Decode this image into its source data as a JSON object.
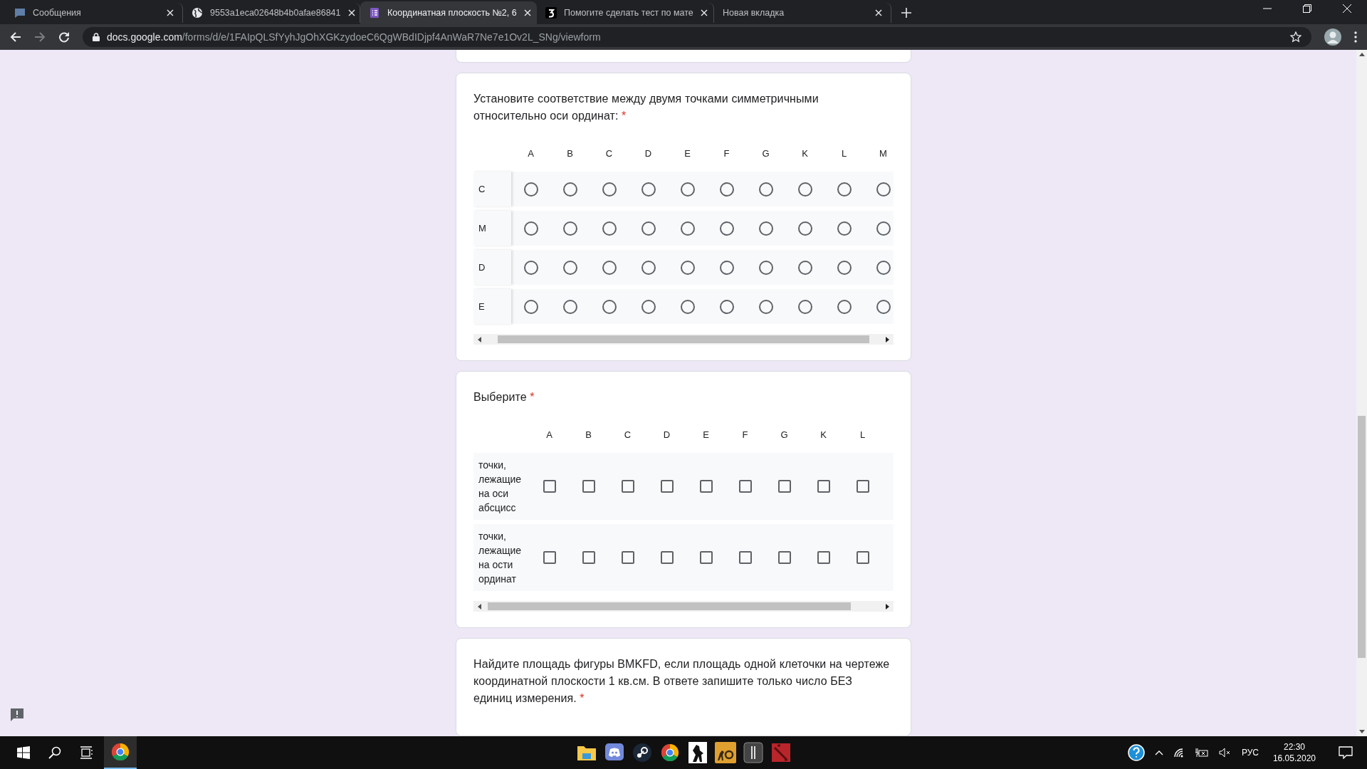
{
  "browser": {
    "tabs": [
      {
        "kind": "chat",
        "title": "Сообщения",
        "selected": false
      },
      {
        "kind": "globe",
        "title": "9553a1eca02648b4b0afae86841",
        "selected": false
      },
      {
        "kind": "forms",
        "title": "Координатная плоскость №2, 6",
        "selected": true
      },
      {
        "kind": "logo",
        "title": "Помогите сделать тест по мате",
        "selected": false
      },
      {
        "kind": "none",
        "title": "Новая вкладка",
        "selected": false
      }
    ],
    "address": {
      "domain": "docs.google.com",
      "path": "/forms/d/e/1FAIpQLSfYyhJgOhXGKzydoeC6QgWBdIDjpf4AnWaR7Ne7e1Ov2L_SNg/viewform"
    },
    "forward_disabled": true
  },
  "form": {
    "questions": [
      {
        "kind": "radio_grid",
        "title": "Установите соответствие между двумя точками симметричными относительно оси ординат:",
        "required_mark": "*",
        "columns": [
          "A",
          "B",
          "C",
          "D",
          "E",
          "F",
          "G",
          "K",
          "L",
          "M"
        ],
        "rows": [
          {
            "label": "C",
            "checked": [
              false,
              false,
              false,
              false,
              false,
              false,
              false,
              false,
              false,
              false
            ]
          },
          {
            "label": "M",
            "checked": [
              false,
              false,
              false,
              false,
              false,
              false,
              false,
              false,
              false,
              false
            ]
          },
          {
            "label": "D",
            "checked": [
              false,
              false,
              false,
              false,
              false,
              false,
              false,
              false,
              false,
              false
            ]
          },
          {
            "label": "E",
            "checked": [
              false,
              false,
              false,
              false,
              false,
              false,
              false,
              false,
              false,
              false
            ]
          }
        ]
      },
      {
        "kind": "checkbox_grid",
        "title": "Выберите",
        "required_mark": "*",
        "columns": [
          "A",
          "B",
          "C",
          "D",
          "E",
          "F",
          "G",
          "K",
          "L"
        ],
        "rows": [
          {
            "label": "точки, лежащие на оси абсцисс",
            "checked": [
              false,
              false,
              false,
              false,
              false,
              false,
              false,
              false,
              false
            ]
          },
          {
            "label": "точки, лежащие на ости ординат",
            "checked": [
              false,
              false,
              false,
              false,
              false,
              false,
              false,
              false,
              false
            ]
          }
        ]
      },
      {
        "kind": "text",
        "title": "Найдите площадь фигуры BMKFD, если площадь одной клеточки на чертеже координатной плоскости 1 кв.см. В ответе запишите только число БЕЗ единиц измерения.",
        "required_mark": "*"
      }
    ]
  },
  "taskbar": {
    "apps": [
      {
        "kind": "chrome",
        "active": true
      },
      {
        "kind": "folder",
        "active": false
      },
      {
        "kind": "discord",
        "active": false
      },
      {
        "kind": "steam",
        "active": false
      },
      {
        "kind": "chrome",
        "active": false
      },
      {
        "kind": "game-figure",
        "active": false
      },
      {
        "kind": "game-go",
        "active": false
      },
      {
        "kind": "game-six",
        "active": false
      },
      {
        "kind": "game-red",
        "active": false
      }
    ],
    "language": "РУС",
    "time": "22:30",
    "date": "16.05.2020"
  }
}
